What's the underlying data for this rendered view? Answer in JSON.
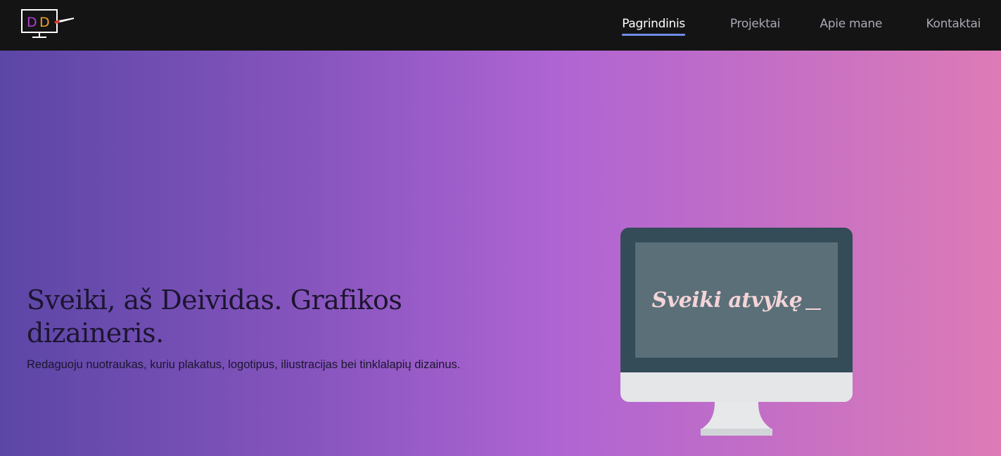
{
  "nav": {
    "logo_alt": "DD",
    "items": [
      {
        "label": "Pagrindinis",
        "active": true
      },
      {
        "label": "Projektai",
        "active": false
      },
      {
        "label": "Apie mane",
        "active": false
      },
      {
        "label": "Kontaktai",
        "active": false
      }
    ]
  },
  "hero": {
    "title": "Sveiki, aš Deividas. Grafikos dizaineris.",
    "subtitle": "Redaguoju nuotraukas, kuriu plakatus, logotipus, iliustracijas bei tinklalapių dizainus.",
    "screen_text": "Sveiki atvykę"
  },
  "colors": {
    "nav_bg": "#141414",
    "nav_active": "#ffffff",
    "nav_inactive": "#a9a9b7",
    "nav_underline": "#6f8ee8",
    "gradient_start": "#5b46a6",
    "gradient_mid": "#ae64d3",
    "gradient_end": "#dd7bb6",
    "monitor_frame": "#344b58",
    "monitor_screen": "#5a6f78",
    "screen_text": "#f4d4d8"
  },
  "icons": {
    "logo": "monitor-dd-brush-logo-icon"
  }
}
